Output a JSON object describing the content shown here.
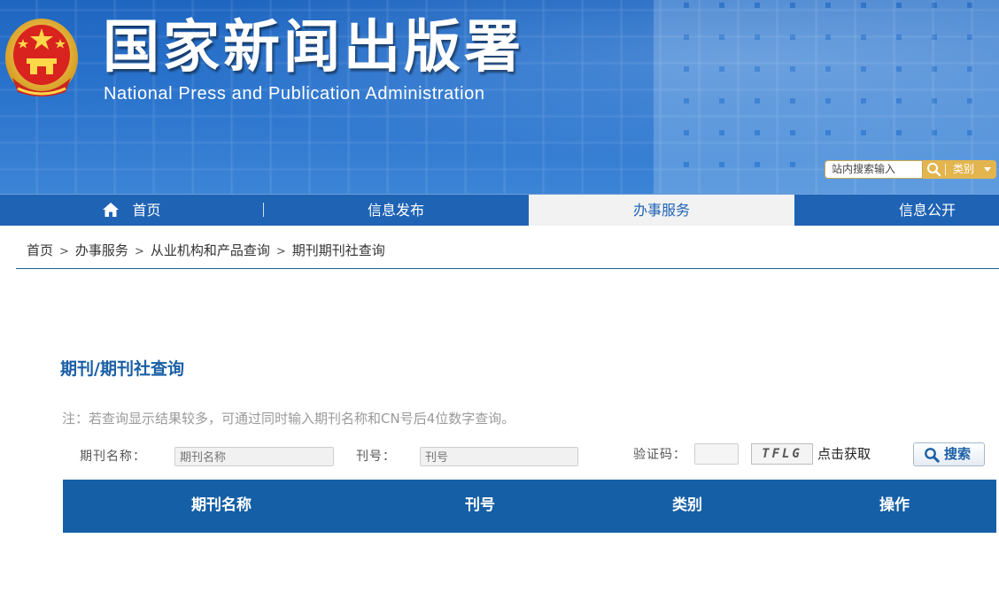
{
  "header": {
    "title_cn": "国家新闻出版署",
    "title_en": "National  Press and Publication Administration",
    "site_search": {
      "placeholder": "站内搜索输入",
      "category_label": "类别"
    }
  },
  "nav": {
    "items": [
      {
        "label": "首页",
        "active": false
      },
      {
        "label": "信息发布",
        "active": false
      },
      {
        "label": "办事服务",
        "active": true
      },
      {
        "label": "信息公开",
        "active": false
      }
    ]
  },
  "breadcrumb": {
    "items": [
      "首页",
      "办事服务",
      "从业机构和产品查询",
      "期刊期刊社查询"
    ],
    "separator": ">"
  },
  "main": {
    "title": "期刊/期刊社查询",
    "note": "注：若查询显示结果较多，可通过同时输入期刊名称和CN号后4位数字查询。",
    "form": {
      "name_label": "期刊名称：",
      "name_placeholder": "期刊名称",
      "issn_label": "刊号：",
      "issn_placeholder": "刊号",
      "captcha_label": "验证码：",
      "captcha_code": "TFLG",
      "captcha_refresh": "点击获取",
      "search_button": "搜索"
    },
    "table": {
      "columns": [
        "期刊名称",
        "刊号",
        "类别",
        "操作"
      ],
      "header_color": "#155fa6"
    }
  },
  "colors": {
    "banner_blue": "#1f66c0",
    "nav_blue": "#1f63b5",
    "title_blue": "#1a5fa6",
    "search_gold": "#e3b54e"
  },
  "icons": {
    "emblem": "national-emblem-icon",
    "home": "home-icon",
    "search": "search-icon",
    "dropdown": "caret-down-icon"
  }
}
